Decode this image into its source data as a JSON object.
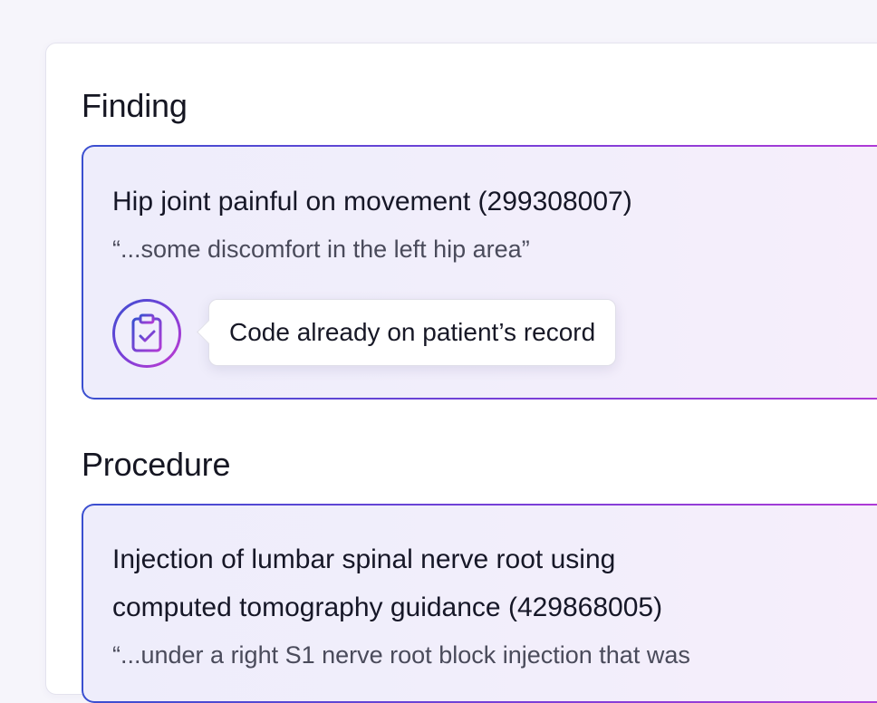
{
  "finding": {
    "heading": "Finding",
    "title": "Hip joint painful on movement (299308007)",
    "quote": "“...some discomfort in the left hip area”",
    "status_icon": "clipboard-check-icon",
    "tooltip": "Code already on patient’s record"
  },
  "procedure": {
    "heading": "Procedure",
    "title_line1": "Injection of lumbar spinal nerve root using",
    "title_line2": "computed tomography guidance (429868005)",
    "quote": "“...under a right S1 nerve root block injection that was"
  },
  "colors": {
    "gradient_start": "#3a4fd0",
    "gradient_end": "#b23ad6"
  }
}
